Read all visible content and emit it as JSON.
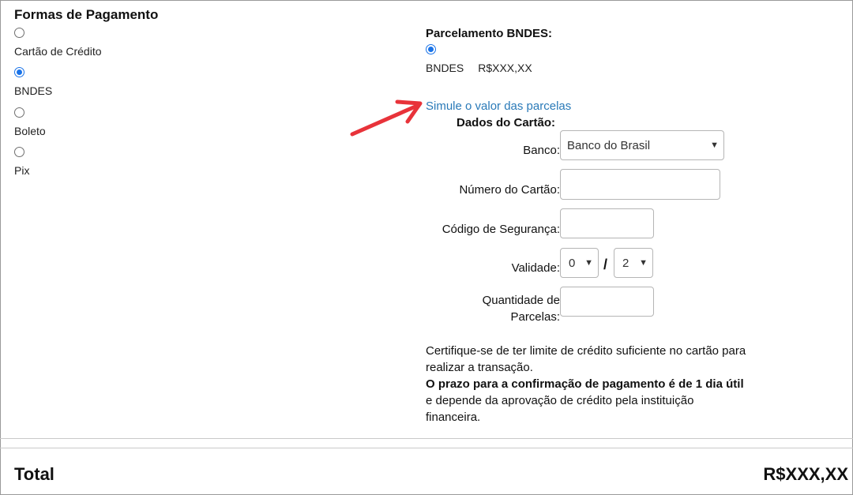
{
  "payment": {
    "title": "Formas de Pagamento",
    "options": [
      {
        "label": "Cartão de Crédito",
        "checked": false
      },
      {
        "label": "BNDES",
        "checked": true
      },
      {
        "label": "Boleto",
        "checked": false
      },
      {
        "label": "Pix",
        "checked": false
      }
    ]
  },
  "bndes": {
    "title": "Parcelamento BNDES:",
    "option_label": "BNDES",
    "option_price": "R$XXX,XX",
    "simulate_link": "Simule o valor das parcelas"
  },
  "card": {
    "title": "Dados do Cartão:",
    "bank_label": "Banco:",
    "bank_value": "Banco do Brasil",
    "number_label": "Número do Cartão:",
    "security_label": "Código de Segurança:",
    "validity_label": "Validade:",
    "month_value": "0",
    "year_value": "2",
    "separator": "/",
    "installments_label_line1": "Quantidade de",
    "installments_label_line2": "Parcelas:"
  },
  "notice": {
    "line1": "Certifique-se de ter limite de crédito suficiente no cartão para realizar a transação.",
    "bold": "O prazo para a confirmação de pagamento é de 1 dia útil",
    "rest": " e depende da aprovação de crédito pela instituição financeira."
  },
  "total": {
    "label": "Total",
    "value": "R$XXX,XX"
  },
  "colors": {
    "link": "#2a7ab8",
    "radio_selected": "#1a73e8",
    "annotation_arrow": "#e8333a"
  }
}
